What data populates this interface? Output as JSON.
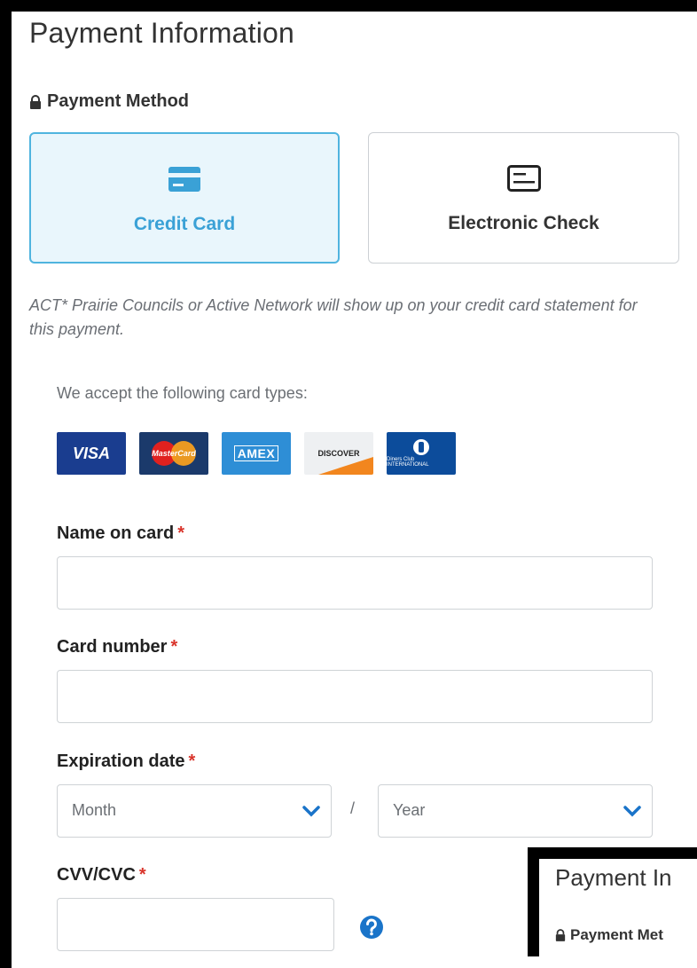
{
  "page": {
    "title": "Payment Information",
    "payment_method_label": "Payment Method"
  },
  "payment_methods": [
    {
      "label": "Credit Card",
      "icon": "credit-card-icon",
      "selected": true
    },
    {
      "label": "Electronic Check",
      "icon": "check-icon",
      "selected": false
    }
  ],
  "statement_note": "ACT* Prairie Councils or Active Network will show up on your credit card statement for this payment.",
  "card_types": {
    "label": "We accept the following card types:",
    "logos": [
      {
        "name": "visa",
        "text": "VISA"
      },
      {
        "name": "mastercard",
        "text": "MasterCard"
      },
      {
        "name": "amex",
        "text": "AMEX"
      },
      {
        "name": "discover",
        "text": "DISCOVER"
      },
      {
        "name": "diners-club",
        "text": "Diners Club INTERNATIONAL"
      }
    ]
  },
  "form": {
    "name_on_card": {
      "label": "Name on card",
      "required_mark": "*",
      "value": ""
    },
    "card_number": {
      "label": "Card number",
      "required_mark": "*",
      "value": ""
    },
    "expiration": {
      "label": "Expiration date",
      "required_mark": "*",
      "month_placeholder": "Month",
      "separator": "/",
      "year_placeholder": "Year"
    },
    "cvv": {
      "label": "CVV/CVC",
      "required_mark": "*",
      "value": ""
    }
  },
  "inset_preview": {
    "title": "Payment In",
    "method_label": "Payment Met"
  },
  "colors": {
    "accent": "#3aa1d6",
    "selected_bg": "#e9f6fc",
    "required": "#d9342b",
    "help": "#1a74c9"
  }
}
